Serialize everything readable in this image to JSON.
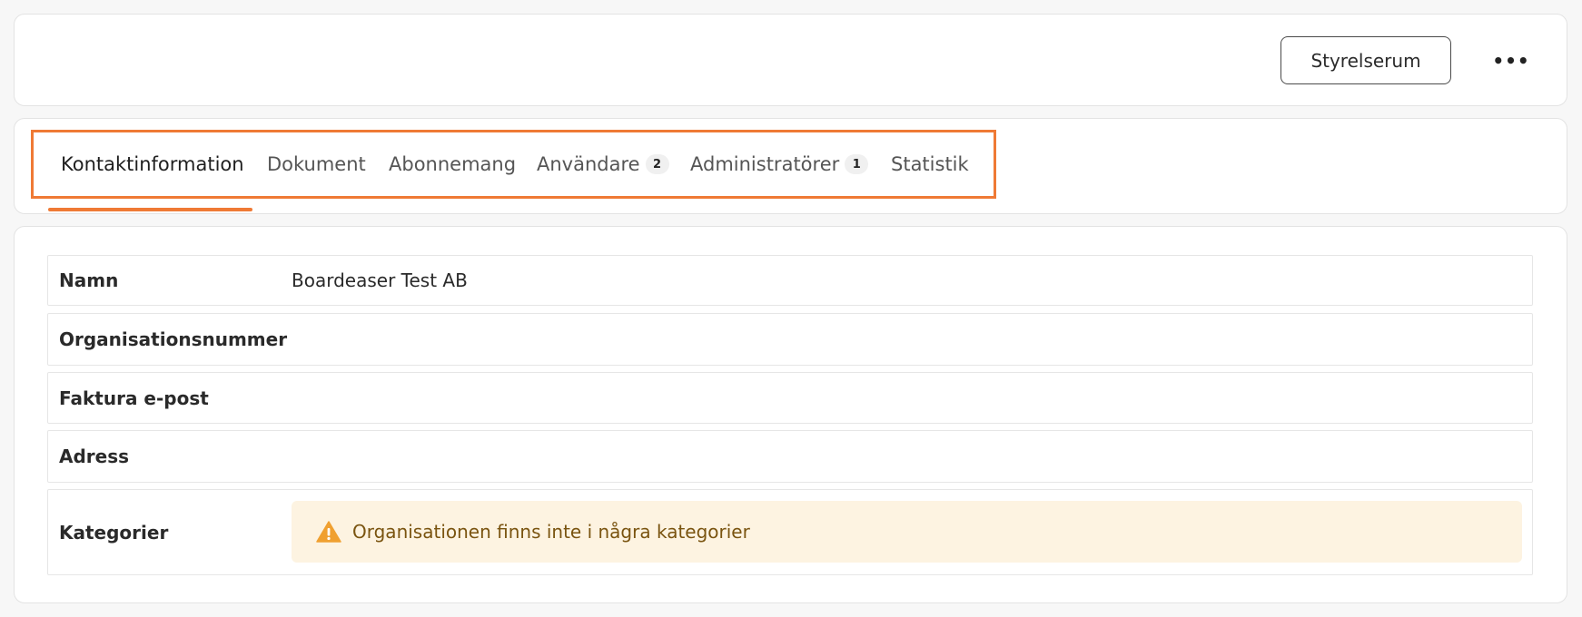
{
  "header": {
    "board_room_button": "Styrelserum",
    "more_button": "•••"
  },
  "tabs": [
    {
      "label": "Kontaktinformation",
      "active": true
    },
    {
      "label": "Dokument"
    },
    {
      "label": "Abonnemang"
    },
    {
      "label": "Användare",
      "badge": "2"
    },
    {
      "label": "Administratörer",
      "badge": "1"
    },
    {
      "label": "Statistik"
    }
  ],
  "colors": {
    "accent": "#ef7a35",
    "alert_bg": "#fdf3e1",
    "alert_icon": "#f0a030",
    "alert_text": "#7a5410"
  },
  "info": {
    "rows": [
      {
        "label": "Namn",
        "value": "Boardeaser Test AB"
      },
      {
        "label": "Organisationsnummer",
        "value": ""
      },
      {
        "label": "Faktura e-post",
        "value": ""
      },
      {
        "label": "Adress",
        "value": ""
      },
      {
        "label": "Kategorier"
      }
    ],
    "categories_alert": {
      "icon": "warning-icon",
      "text": "Organisationen finns inte i några kategorier"
    }
  }
}
